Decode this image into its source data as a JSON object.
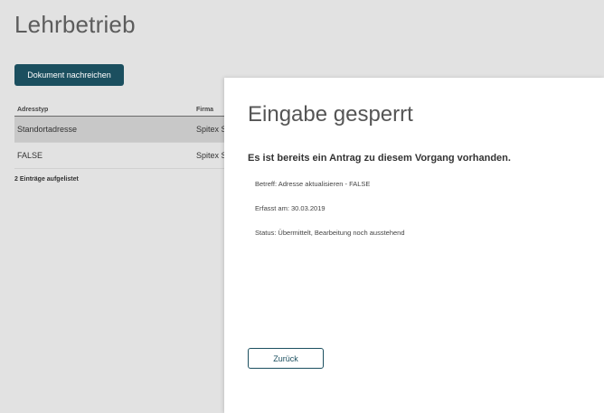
{
  "page": {
    "title": "Lehrbetrieb"
  },
  "toolbar": {
    "upload_button_label": "Dokument nachreichen"
  },
  "table": {
    "headers": [
      "Adresstyp",
      "Firma"
    ],
    "rows": [
      [
        "Standortadresse",
        "Spitex S"
      ],
      [
        "FALSE",
        "Spitex S"
      ]
    ],
    "count_label": "2 Einträge aufgelistet"
  },
  "modal": {
    "title": "Eingabe gesperrt",
    "subtitle": "Es ist bereits ein Antrag zu diesem Vorgang vorhanden.",
    "lines": [
      "Betreff: Adresse aktualisieren - FALSE",
      "Erfasst am: 30.03.2019",
      "Status: Übermittelt, Bearbeitung noch ausstehend"
    ],
    "back_button_label": "Zurück"
  },
  "colors": {
    "accent": "#1b4f5f",
    "background": "#e2e2e2",
    "row_highlight": "#c8c8c8"
  }
}
